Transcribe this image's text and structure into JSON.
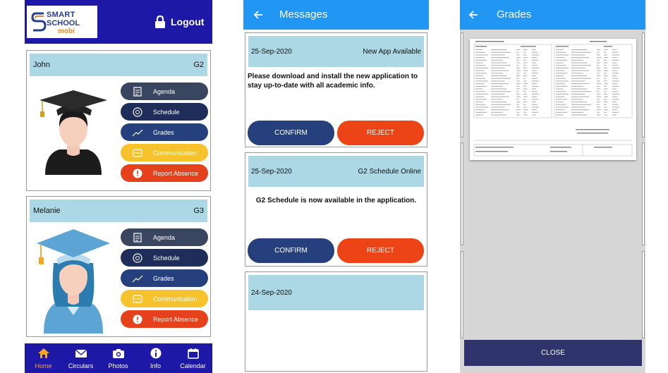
{
  "home": {
    "logo": {
      "line1": "SMART",
      "line2": "SCHOOL",
      "line3": "mobi"
    },
    "logout_label": "Logout",
    "students": [
      {
        "name": "John",
        "grade": "G2",
        "avatar": "graduate-boy-icon",
        "menu": [
          {
            "label": "Agenda",
            "icon": "agenda-icon",
            "color": "#3a4660"
          },
          {
            "label": "Schedule",
            "icon": "schedule-icon",
            "color": "#1f2d5a"
          },
          {
            "label": "Grades",
            "icon": "grades-chart-icon",
            "color": "#26407d"
          },
          {
            "label": "Communication",
            "icon": "chat-icon",
            "color": "#f6c32d"
          },
          {
            "label": "Report Absence",
            "icon": "alert-icon",
            "color": "#e6411d"
          }
        ]
      },
      {
        "name": "Melanie",
        "grade": "G3",
        "avatar": "graduate-girl-icon",
        "menu": [
          {
            "label": "Agenda",
            "icon": "agenda-icon",
            "color": "#3a4660"
          },
          {
            "label": "Schedule",
            "icon": "schedule-icon",
            "color": "#1f2d5a"
          },
          {
            "label": "Grades",
            "icon": "grades-chart-icon",
            "color": "#26407d"
          },
          {
            "label": "Communication",
            "icon": "chat-icon",
            "color": "#f6c32d"
          },
          {
            "label": "Report Absence",
            "icon": "alert-icon",
            "color": "#e6411d"
          }
        ]
      }
    ],
    "tabs": [
      {
        "label": "Home",
        "icon": "home-icon",
        "active": true
      },
      {
        "label": "Circulars",
        "icon": "envelope-icon",
        "active": false
      },
      {
        "label": "Photos",
        "icon": "camera-icon",
        "active": false
      },
      {
        "label": "Info",
        "icon": "info-icon",
        "active": false
      },
      {
        "label": "Calendar",
        "icon": "calendar-icon",
        "active": false
      }
    ],
    "colors": {
      "header": "#1d18a6",
      "active_tab": "#f6a623",
      "student_bar": "#acd8e6"
    }
  },
  "messages": {
    "title": "Messages",
    "items": [
      {
        "date": "25-Sep-2020",
        "title": "New App Available",
        "body": "Please download and install the new application to stay up-to-date with all academic info.",
        "confirm_label": "CONFIRM",
        "reject_label": "REJECT"
      },
      {
        "date": "25-Sep-2020",
        "title": "G2 Schedule Online",
        "body": "G2 Schedule is now available in the application.",
        "confirm_label": "CONFIRM",
        "reject_label": "REJECT"
      },
      {
        "date": "24-Sep-2020",
        "title": "",
        "body": ""
      }
    ],
    "colors": {
      "appbar": "#2196f3",
      "confirm": "#26407d",
      "reject": "#ec4416"
    }
  },
  "grades": {
    "title": "Grades",
    "close_label": "CLOSE",
    "document": "report-card-thumbnail",
    "colors": {
      "overlay": "#d6d6d6",
      "close_bar": "#2f356c"
    }
  }
}
